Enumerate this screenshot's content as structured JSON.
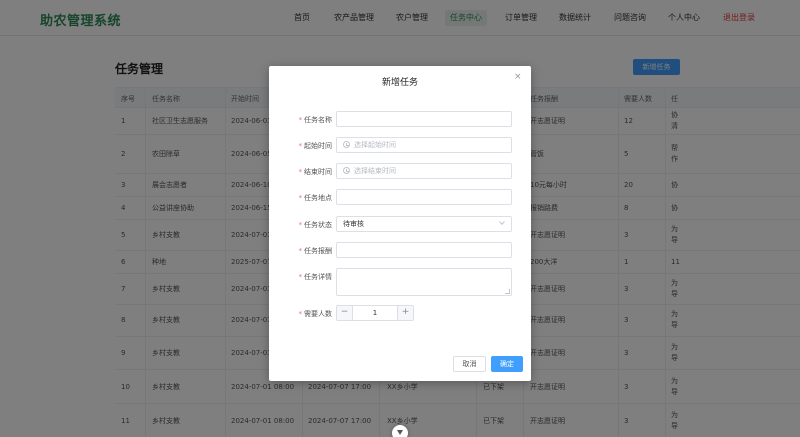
{
  "header": {
    "brand": "助农管理系统",
    "nav": [
      {
        "label": "首页"
      },
      {
        "label": "农产品管理"
      },
      {
        "label": "农户管理"
      },
      {
        "label": "任务中心"
      },
      {
        "label": "订单管理"
      },
      {
        "label": "数据统计"
      },
      {
        "label": "问题咨询"
      },
      {
        "label": "个人中心"
      },
      {
        "label": "退出登录"
      }
    ],
    "active_nav": "任务中心"
  },
  "page": {
    "title": "任务管理",
    "add_button": "新增任务"
  },
  "table": {
    "columns": [
      "序号",
      "任务名称",
      "开始时间",
      "",
      "",
      "",
      "任务报酬",
      "需要人数",
      "任"
    ],
    "rows": [
      {
        "no": "1",
        "name": "社区卫生志愿服务",
        "start": "2024-06-01",
        "end": "",
        "place": "",
        "status": "",
        "reward": "开志愿证明",
        "people": "12",
        "more": "协清"
      },
      {
        "no": "2",
        "name": "农田除草",
        "start": "2024-06-05",
        "end": "",
        "place": "",
        "status": "",
        "reward": "管饭",
        "people": "5",
        "more": "帮作"
      },
      {
        "no": "3",
        "name": "展会志愿者",
        "start": "2024-06-10",
        "end": "",
        "place": "",
        "status": "",
        "reward": "10元每小时",
        "people": "20",
        "more": "协"
      },
      {
        "no": "4",
        "name": "公益讲座协助",
        "start": "2024-06-15",
        "end": "",
        "place": "",
        "status": "",
        "reward": "报销路费",
        "people": "8",
        "more": "协"
      },
      {
        "no": "5",
        "name": "乡村支教",
        "start": "2024-07-01",
        "end": "",
        "place": "",
        "status": "",
        "reward": "开志愿证明",
        "people": "3",
        "more": "为导"
      },
      {
        "no": "6",
        "name": "种地",
        "start": "2025-07-07",
        "end": "",
        "place": "",
        "status": "",
        "reward": "200大洋",
        "people": "1",
        "more": "11"
      },
      {
        "no": "7",
        "name": "乡村支教",
        "start": "2024-07-01",
        "end": "",
        "place": "",
        "status": "",
        "reward": "开志愿证明",
        "people": "3",
        "more": "为导"
      },
      {
        "no": "8",
        "name": "乡村支教",
        "start": "2024-07-01",
        "end": "",
        "place": "",
        "status": "",
        "reward": "开志愿证明",
        "people": "3",
        "more": "为导"
      },
      {
        "no": "9",
        "name": "乡村支教",
        "start": "2024-07-01",
        "end": "",
        "place": "",
        "status": "",
        "reward": "开志愿证明",
        "people": "3",
        "more": "为导"
      },
      {
        "no": "10",
        "name": "乡村支教",
        "start": "2024-07-01 08:00",
        "end": "2024-07-07 17:00",
        "place": "XX乡小学",
        "status": "已下架",
        "reward": "开志愿证明",
        "people": "3",
        "more": "为导"
      },
      {
        "no": "11",
        "name": "乡村支教",
        "start": "2024-07-01 08:00",
        "end": "2024-07-07 17:00",
        "place": "XX乡小学",
        "status": "已下架",
        "reward": "开志愿证明",
        "people": "3",
        "more": "为导"
      }
    ]
  },
  "dialog": {
    "title": "新增任务",
    "close": "×",
    "fields": {
      "name": {
        "label": "任务名称",
        "value": ""
      },
      "start": {
        "label": "起始时间",
        "placeholder": "选择起始时间"
      },
      "end": {
        "label": "结束时间",
        "placeholder": "选择结束时间"
      },
      "place": {
        "label": "任务地点",
        "value": ""
      },
      "status": {
        "label": "任务状态",
        "value": "待审核"
      },
      "reward": {
        "label": "任务报酬",
        "value": ""
      },
      "detail": {
        "label": "任务详情",
        "value": ""
      },
      "people": {
        "label": "需要人数",
        "value": "1",
        "minus": "−",
        "plus": "+"
      }
    },
    "cancel": "取消",
    "confirm": "确定"
  },
  "colors": {
    "brand": "#2e8b57",
    "primary": "#409eff",
    "danger": "#e53935",
    "required": "#f56c6c"
  },
  "icons": [
    "clock-icon",
    "chevron-down-icon",
    "close-icon",
    "scroll-top-icon"
  ]
}
